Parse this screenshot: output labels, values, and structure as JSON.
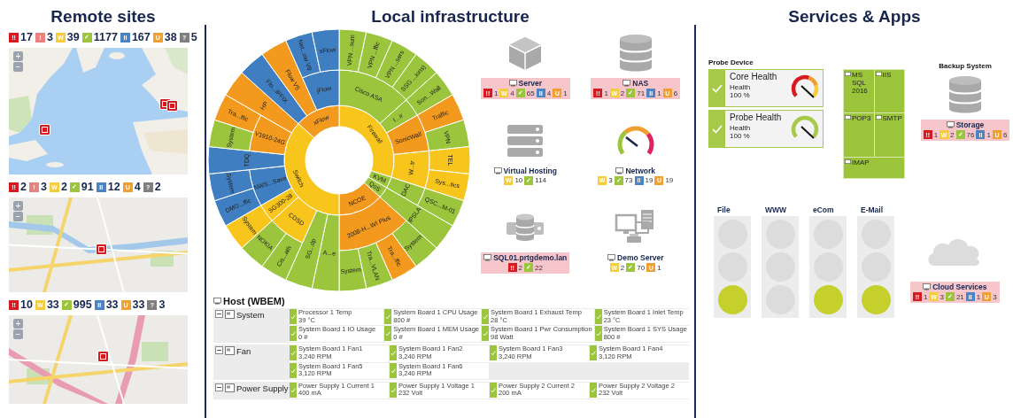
{
  "remote": {
    "title": "Remote sites",
    "sites": [
      {
        "counts": [
          {
            "kind": "down",
            "glyph": "!!",
            "count": "17"
          },
          {
            "kind": "ack",
            "glyph": "!",
            "count": "3"
          },
          {
            "kind": "warning",
            "glyph": "W",
            "count": "39"
          },
          {
            "kind": "up",
            "glyph": "✓",
            "count": "1177"
          },
          {
            "kind": "paused",
            "glyph": "II",
            "count": "167"
          },
          {
            "kind": "unusual",
            "glyph": "U",
            "count": "38"
          },
          {
            "kind": "unknown",
            "glyph": "?",
            "count": "5"
          }
        ],
        "map": {
          "kind": "world",
          "controls": [
            "+",
            "−"
          ],
          "markers": [
            {
              "kind": "down"
            },
            {
              "kind": "down"
            },
            {
              "kind": "down"
            }
          ]
        }
      },
      {
        "counts": [
          {
            "kind": "down",
            "glyph": "!!",
            "count": "2"
          },
          {
            "kind": "ack",
            "glyph": "!",
            "count": "3"
          },
          {
            "kind": "warning",
            "glyph": "W",
            "count": "2"
          },
          {
            "kind": "up",
            "glyph": "✓",
            "count": "91"
          },
          {
            "kind": "paused",
            "glyph": "II",
            "count": "12"
          },
          {
            "kind": "unusual",
            "glyph": "U",
            "count": "4"
          },
          {
            "kind": "unknown",
            "glyph": "?",
            "count": "2"
          }
        ],
        "map": {
          "kind": "city",
          "controls": [
            "+",
            "−"
          ],
          "markers": [
            {
              "kind": "down"
            }
          ]
        }
      },
      {
        "counts": [
          {
            "kind": "down",
            "glyph": "!!",
            "count": "10"
          },
          {
            "kind": "warning",
            "glyph": "W",
            "count": "33"
          },
          {
            "kind": "up",
            "glyph": "✓",
            "count": "995"
          },
          {
            "kind": "paused",
            "glyph": "II",
            "count": "33"
          },
          {
            "kind": "unusual",
            "glyph": "U",
            "count": "33"
          },
          {
            "kind": "unknown",
            "glyph": "?",
            "count": "3"
          }
        ],
        "map": {
          "kind": "highway",
          "controls": [
            "+",
            "−"
          ],
          "markers": [
            {
              "kind": "down"
            }
          ]
        }
      }
    ]
  },
  "local": {
    "title": "Local infrastructure",
    "sunburst": [
      {
        "label": "Firewall",
        "color": "#f8c51c",
        "children": [
          {
            "label": "Cisco ASA",
            "color": "#9bc53d",
            "children": [
              {
                "label": "VPN ...sum",
                "color": "#9bc53d"
              },
              {
                "label": "VPN ...ffic",
                "color": "#9bc53d"
              },
              {
                "label": "VPN ...sers",
                "color": "#9bc53d"
              },
              {
                "label": "SSG ...ions)",
                "color": "#9bc53d"
              }
            ]
          },
          {
            "label": "I...ir",
            "color": "#9bc53d",
            "children": [
              {
                "label": "Son...Wall",
                "color": "#9bc53d"
              }
            ]
          },
          {
            "label": "SonicWall",
            "color": "#f39a1e",
            "children": [
              {
                "label": "Traffic",
                "color": "#f39a1e"
              },
              {
                "label": "VPN",
                "color": "#9bc53d"
              }
            ]
          },
          {
            "label": "W...tr",
            "color": "#f8c51c",
            "children": [
              {
                "label": "TEL",
                "color": "#f8c51c"
              },
              {
                "label": "Sys...tics",
                "color": "#f8c51c"
              }
            ]
          }
        ]
      },
      {
        "label": "KVM",
        "color": "#9bc53d",
        "children": [
          {
            "label": "DAC",
            "color": "#9bc53d",
            "children": [
              {
                "label": "QSC...M-01",
                "color": "#9bc53d"
              }
            ]
          }
        ]
      },
      {
        "label": "QoS",
        "color": "#9bc53d",
        "children": [
          {
            "label": "IPSLA",
            "color": "#9bc53d"
          }
        ]
      },
      {
        "label": "NCOE",
        "color": "#f39a1e",
        "children": [
          {
            "label": "2008-H...WI Plus",
            "color": "#f39a1e",
            "children": [
              {
                "label": "System",
                "color": "#9bc53d"
              },
              {
                "label": "Tra...ffic",
                "color": "#f39a1e"
              },
              {
                "label": "Tra...VLAN",
                "color": "#9bc53d"
              },
              {
                "label": "System",
                "color": "#9bc53d"
              }
            ]
          }
        ]
      },
      {
        "label": "Switch",
        "color": "#f8c51c",
        "children": [
          {
            "label": "A...e",
            "color": "#9bc53d"
          },
          {
            "label": "SG...dp",
            "color": "#9bc53d"
          },
          {
            "label": "CDSD",
            "color": "#f8c51c",
            "children": [
              {
                "label": "Cis...ath",
                "color": "#9bc53d"
              },
              {
                "label": "NOKIA",
                "color": "#9bc53d"
              }
            ]
          },
          {
            "label": "SG300-28",
            "color": "#f8c51c",
            "children": [
              {
                "label": "System",
                "color": "#f8c51c"
              }
            ]
          },
          {
            "label": "NWS...Save",
            "color": "#3f7fc1",
            "children": [
              {
                "label": "DMO...ffic",
                "color": "#3f7fc1"
              },
              {
                "label": "System",
                "color": "#3f7fc1"
              }
            ]
          },
          {
            "label": "TDQ",
            "color": "#3f7fc1"
          },
          {
            "label": "V1910-24G",
            "color": "#f39a1e",
            "children": [
              {
                "label": "System",
                "color": "#9bc53d"
              },
              {
                "label": "Tra...ffic",
                "color": "#f39a1e"
              }
            ]
          },
          {
            "label": "HP",
            "color": "#f39a1e"
          }
        ]
      },
      {
        "label": "xFlow",
        "color": "#f39a1e",
        "children": [
          {
            "label": "Flo...IPFIX",
            "color": "#3f7fc1"
          },
          {
            "label": "Flow V5",
            "color": "#f39a1e"
          },
          {
            "label": "jFlow",
            "color": "#3f7fc1",
            "children": [
              {
                "label": "Net...ow V9",
                "color": "#3f7fc1"
              },
              {
                "label": "sFlow",
                "color": "#3f7fc1"
              }
            ]
          }
        ]
      }
    ],
    "devices": [
      {
        "kind": "box",
        "name": "Server",
        "highlighted": true,
        "counts": [
          {
            "kind": "down",
            "glyph": "!!",
            "count": "1"
          },
          {
            "kind": "warning",
            "glyph": "W",
            "count": "4"
          },
          {
            "kind": "up",
            "glyph": "✓",
            "count": "65"
          },
          {
            "kind": "paused",
            "glyph": "II",
            "count": "4"
          },
          {
            "kind": "unusual",
            "glyph": "U",
            "count": "1"
          }
        ]
      },
      {
        "kind": "database",
        "name": "NAS",
        "highlighted": true,
        "counts": [
          {
            "kind": "down",
            "glyph": "!!",
            "count": "1"
          },
          {
            "kind": "warning",
            "glyph": "W",
            "count": "2"
          },
          {
            "kind": "up",
            "glyph": "✓",
            "count": "71"
          },
          {
            "kind": "paused",
            "glyph": "II",
            "count": "1"
          },
          {
            "kind": "unusual",
            "glyph": "U",
            "count": "6"
          }
        ]
      },
      {
        "kind": "servers",
        "name": "Virtual Hosting",
        "highlighted": false,
        "counts": [
          {
            "kind": "warning",
            "glyph": "W",
            "count": "10"
          },
          {
            "kind": "up",
            "glyph": "✓",
            "count": "114"
          }
        ]
      },
      {
        "kind": "gauge",
        "name": "Network",
        "highlighted": false,
        "counts": [
          {
            "kind": "warning",
            "glyph": "W",
            "count": "3"
          },
          {
            "kind": "up",
            "glyph": "✓",
            "count": "73"
          },
          {
            "kind": "paused",
            "glyph": "II",
            "count": "19"
          },
          {
            "kind": "unusual",
            "glyph": "U",
            "count": "19"
          }
        ]
      },
      {
        "kind": "db-server",
        "name": "SQL01.prtgdemo.lan",
        "highlighted": true,
        "counts": [
          {
            "kind": "down",
            "glyph": "!!",
            "count": "2"
          },
          {
            "kind": "up",
            "glyph": "✓",
            "count": "22"
          }
        ]
      },
      {
        "kind": "computers",
        "name": "Demo Server",
        "highlighted": false,
        "counts": [
          {
            "kind": "warning",
            "glyph": "W",
            "count": "2"
          },
          {
            "kind": "up",
            "glyph": "✓",
            "count": "70"
          },
          {
            "kind": "unusual",
            "glyph": "U",
            "count": "1"
          }
        ]
      }
    ],
    "host": {
      "title": "Host (WBEM)",
      "groups": [
        {
          "name": "System",
          "expanded": true,
          "sensors": [
            {
              "name": "Processor 1 Temp",
              "value": "39 °C"
            },
            {
              "name": "System Board 1 CPU Usage",
              "value": "800 #"
            },
            {
              "name": "System Board 1 Exhaust Temp",
              "value": "28 °C"
            },
            {
              "name": "System Board 1 Inlet Temp",
              "value": "23 °C"
            },
            {
              "name": "System Board 1 IO Usage",
              "value": "0 #"
            },
            {
              "name": "System Board 1 MEM Usage",
              "value": "0 #"
            },
            {
              "name": "System Board 1 Pwr Consumption",
              "value": "98 Watt"
            },
            {
              "name": "System Board 1 SYS Usage",
              "value": "800 #"
            }
          ]
        },
        {
          "name": "Fan",
          "expanded": true,
          "sensors": [
            {
              "name": "System Board 1 Fan1",
              "value": "3,240 RPM"
            },
            {
              "name": "System Board 1 Fan2",
              "value": "3,240 RPM"
            },
            {
              "name": "System Board 1 Fan3",
              "value": "3,240 RPM"
            },
            {
              "name": "System Board 1 Fan4",
              "value": "3,120 RPM"
            },
            {
              "name": "System Board 1 Fan5",
              "value": "3,120 RPM"
            },
            {
              "name": "System Board 1 Fan6",
              "value": "3,240 RPM"
            }
          ]
        },
        {
          "name": "Power Supply",
          "expanded": true,
          "sensors": [
            {
              "name": "Power Supply 1 Current 1",
              "value": "400 mA"
            },
            {
              "name": "Power Supply 1 Voltage 1",
              "value": "232 Volt"
            },
            {
              "name": "Power Supply 2 Current 2",
              "value": "200 mA"
            },
            {
              "name": "Power Supply 2 Voltage 2",
              "value": "232 Volt"
            }
          ]
        }
      ]
    }
  },
  "services": {
    "title": "Services & Apps",
    "probe": {
      "title": "Probe Device",
      "cards": [
        {
          "name": "Core Health",
          "label": "Health",
          "value": "100 %",
          "kind": "critical"
        },
        {
          "name": "Probe Health",
          "label": "Health",
          "value": "100 %",
          "kind": "good"
        }
      ]
    },
    "treemap": [
      {
        "name": "MS SQL 2016"
      },
      {
        "name": "IIS"
      },
      {
        "name": "POP3"
      },
      {
        "name": "SMTP"
      },
      {
        "name": "IMAP"
      }
    ],
    "backup": {
      "title": "Backup System",
      "kind": "database",
      "name": "Storage",
      "highlighted": true,
      "counts": [
        {
          "kind": "down",
          "glyph": "!!",
          "count": "1"
        },
        {
          "kind": "warning",
          "glyph": "W",
          "count": "2"
        },
        {
          "kind": "up",
          "glyph": "✓",
          "count": "76"
        },
        {
          "kind": "paused",
          "glyph": "II",
          "count": "1"
        },
        {
          "kind": "unusual",
          "glyph": "U",
          "count": "6"
        }
      ]
    },
    "lights": [
      {
        "name": "File",
        "lamps": [
          {
            "on": false
          },
          {
            "on": false
          },
          {
            "on": true
          }
        ]
      },
      {
        "name": "WWW",
        "lamps": [
          {
            "on": false
          },
          {
            "on": false
          },
          {
            "on": false
          }
        ]
      },
      {
        "name": "eCom",
        "lamps": [
          {
            "on": false
          },
          {
            "on": false
          },
          {
            "on": true
          }
        ]
      },
      {
        "name": "E-Mail",
        "lamps": [
          {
            "on": false
          },
          {
            "on": false
          },
          {
            "on": true
          }
        ]
      }
    ],
    "cloud": {
      "kind": "cloud",
      "name": "Cloud Services",
      "highlighted": true,
      "counts": [
        {
          "kind": "down",
          "glyph": "!!",
          "count": "1"
        },
        {
          "kind": "warning",
          "glyph": "W",
          "count": "3"
        },
        {
          "kind": "up",
          "glyph": "✓",
          "count": "21"
        },
        {
          "kind": "paused",
          "glyph": "II",
          "count": "1"
        },
        {
          "kind": "unusual",
          "glyph": "U",
          "count": "3"
        }
      ]
    }
  }
}
